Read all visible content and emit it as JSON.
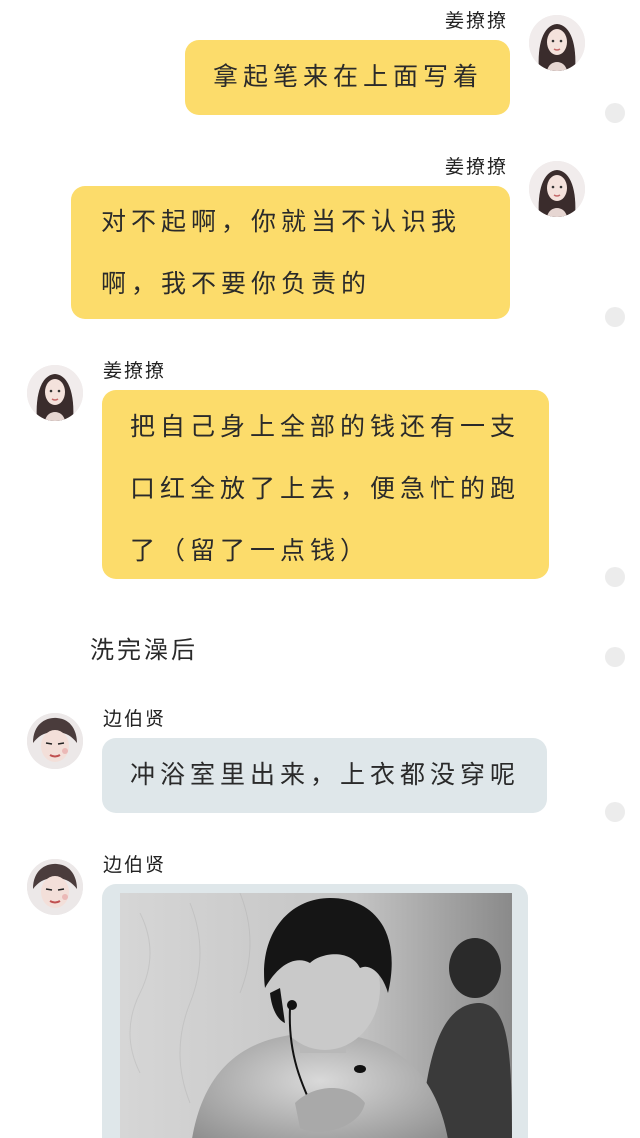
{
  "messages": [
    {
      "sender": "姜撩撩",
      "lines": [
        "拿起笔来在上面写着"
      ]
    },
    {
      "sender": "姜撩撩",
      "lines": [
        "对不起啊，你就当不认识我",
        "啊，我不要你负责的"
      ]
    },
    {
      "sender": "姜撩撩",
      "lines": [
        "把自己身上全部的钱还有一支",
        "口红全放了上去，便急忙的跑",
        "了（留了一点钱）"
      ]
    },
    {
      "narration": "洗完澡后"
    },
    {
      "sender": "边伯贤",
      "lines": [
        "冲浴室里出来，上衣都没穿呢"
      ]
    },
    {
      "sender": "边伯贤",
      "type": "image",
      "image_desc": "black-and-white photo of a shirtless man with messy dark hair looking down"
    }
  ],
  "colors": {
    "self_bubble": "#fcdc6b",
    "other_bubble": "#dfe7ea",
    "background": "#ffffff"
  }
}
